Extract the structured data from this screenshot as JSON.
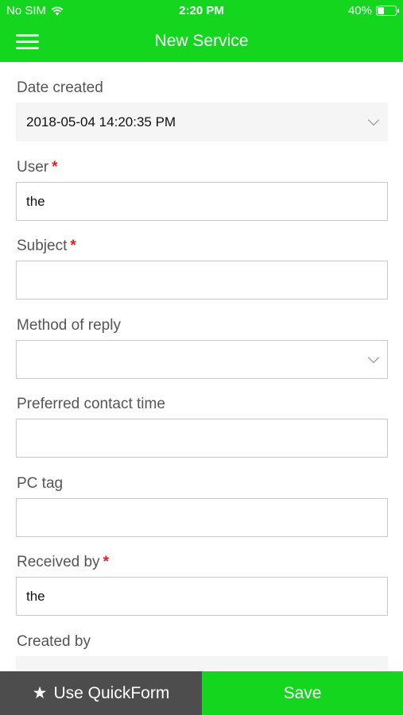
{
  "status_bar": {
    "carrier": "No SIM",
    "time": "2:20 PM",
    "battery_text": "40%",
    "battery_level": 0.4,
    "wifi_icon": "wifi-icon",
    "battery_icon": "battery-icon"
  },
  "nav": {
    "title": "New Service",
    "menu_icon": "hamburger-menu-icon"
  },
  "form": {
    "date_created": {
      "label": "Date created",
      "value": "2018-05-04 14:20:35 PM"
    },
    "user": {
      "label": "User",
      "required_mark": "*",
      "value": "the"
    },
    "subject": {
      "label": "Subject",
      "required_mark": "*",
      "value": ""
    },
    "method_of_reply": {
      "label": "Method of reply",
      "value": ""
    },
    "preferred_contact_time": {
      "label": "Preferred contact time",
      "value": ""
    },
    "pc_tag": {
      "label": "PC tag",
      "value": ""
    },
    "received_by": {
      "label": "Received by",
      "required_mark": "*",
      "value": "the"
    },
    "created_by": {
      "label": "Created by",
      "value": ""
    }
  },
  "footer": {
    "quickform_icon": "★",
    "quickform_label": "Use QuickForm",
    "save_label": "Save"
  },
  "colors": {
    "accent": "#14d61e",
    "footer_dark": "#4d4d4d",
    "required": "#e02020"
  }
}
